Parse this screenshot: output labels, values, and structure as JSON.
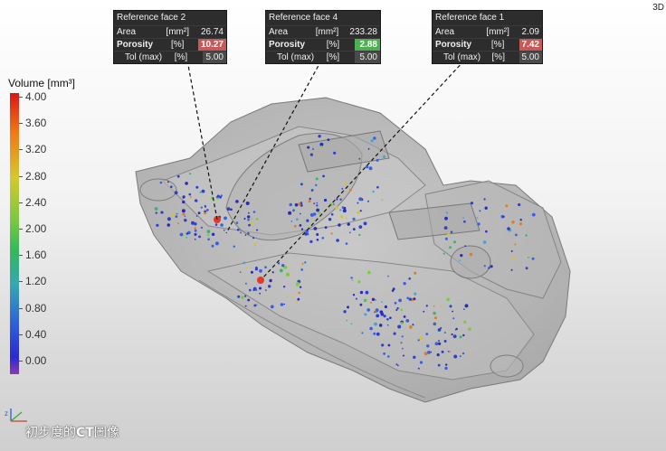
{
  "view_label": "3D",
  "reference_faces": [
    {
      "title": "Reference face 2",
      "area_label": "Area",
      "area_unit": "[mm²]",
      "area_value": "26.74",
      "porosity_label": "Porosity",
      "porosity_unit": "[%]",
      "porosity_value": "10.27",
      "porosity_status": "red",
      "tol_label": "Tol (max)",
      "tol_unit": "[%]",
      "tol_value": "5.00"
    },
    {
      "title": "Reference face 4",
      "area_label": "Area",
      "area_unit": "[mm²]",
      "area_value": "233.28",
      "porosity_label": "Porosity",
      "porosity_unit": "[%]",
      "porosity_value": "2.88",
      "porosity_status": "green",
      "tol_label": "Tol (max)",
      "tol_unit": "[%]",
      "tol_value": "5.00"
    },
    {
      "title": "Reference face 1",
      "area_label": "Area",
      "area_unit": "[mm²]",
      "area_value": "2.09",
      "porosity_label": "Porosity",
      "porosity_unit": "[%]",
      "porosity_value": "7.42",
      "porosity_status": "red",
      "tol_label": "Tol (max)",
      "tol_unit": "[%]",
      "tol_value": "5.00"
    }
  ],
  "legend": {
    "title": "Volume [mm³]",
    "ticks": [
      "4.00",
      "3.60",
      "3.20",
      "2.80",
      "2.40",
      "2.00",
      "1.60",
      "1.20",
      "0.80",
      "0.40",
      "0.00"
    ]
  },
  "caption_prefix": "初步度的",
  "caption_bold": "CT",
  "caption_suffix": "圖像",
  "colors": {
    "red_flag": "#c95859",
    "green_flag": "#4caf50",
    "panel": "#2d2d2d"
  }
}
